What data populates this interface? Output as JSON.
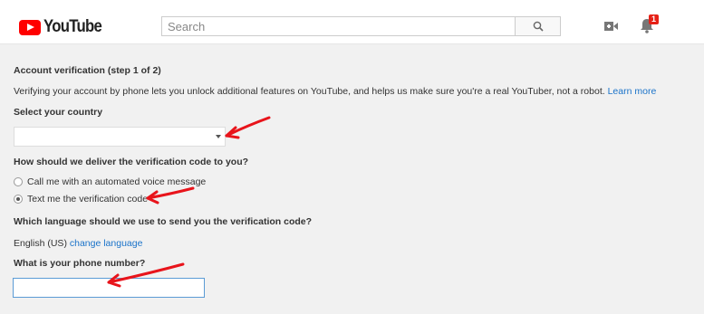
{
  "header": {
    "logo_text": "YouTube",
    "search_placeholder": "Search",
    "notification_count": "1"
  },
  "verification": {
    "title": "Account verification (step 1 of 2)",
    "description": "Verifying your account by phone lets you unlock additional features on YouTube, and helps us make sure you're a real YouTuber, not a robot.",
    "learn_more": "Learn more",
    "country_label": "Select your country",
    "country_value": "",
    "delivery_label": "How should we deliver the verification code to you?",
    "delivery_options": [
      {
        "label": "Call me with an automated voice message",
        "selected": false
      },
      {
        "label": "Text me the verification code",
        "selected": true
      }
    ],
    "language_label": "Which language should we use to send you the verification code?",
    "language_value": "English (US)",
    "change_language": "change language",
    "phone_label": "What is your phone number?",
    "phone_value": ""
  },
  "annotations": {
    "arrow_color": "#e8141b"
  }
}
